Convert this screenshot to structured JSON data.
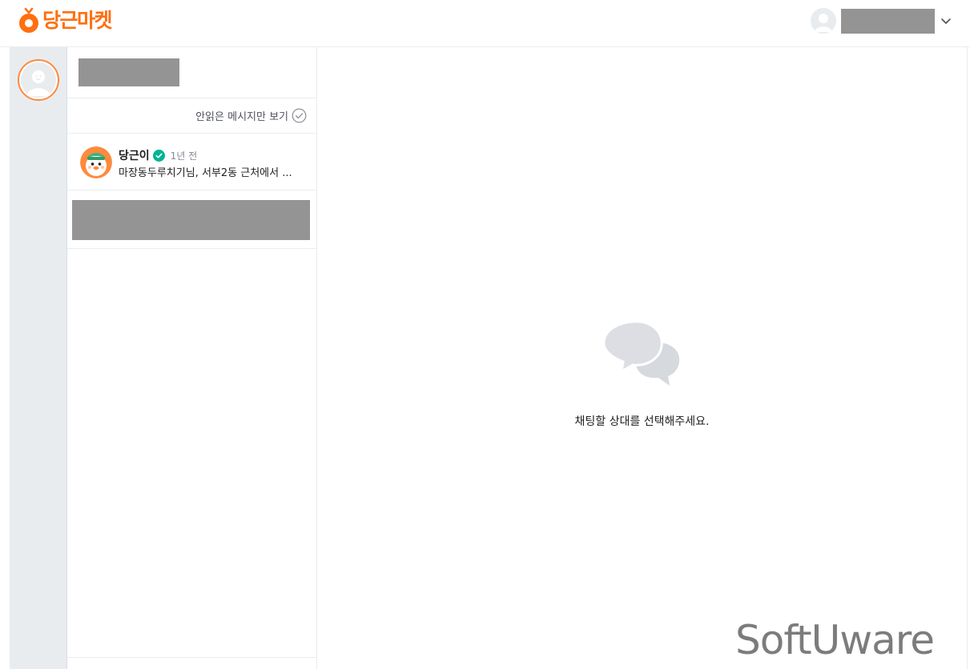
{
  "header": {
    "logo_text": "당근마켓"
  },
  "chat_list": {
    "unread_filter_label": "안읽은 메시지만 보기",
    "items": [
      {
        "name": "당근이",
        "time": "1년 전",
        "preview": "마장동두루치기님, 서부2동 근처에서 ..."
      }
    ]
  },
  "main": {
    "empty_message": "채팅할 상대를 선택해주세요."
  },
  "watermark": "SoftUware",
  "colors": {
    "brand": "#ff6f0f",
    "verified": "#00b493",
    "rail_bg": "#e9ecef",
    "redaction": "#949494"
  }
}
